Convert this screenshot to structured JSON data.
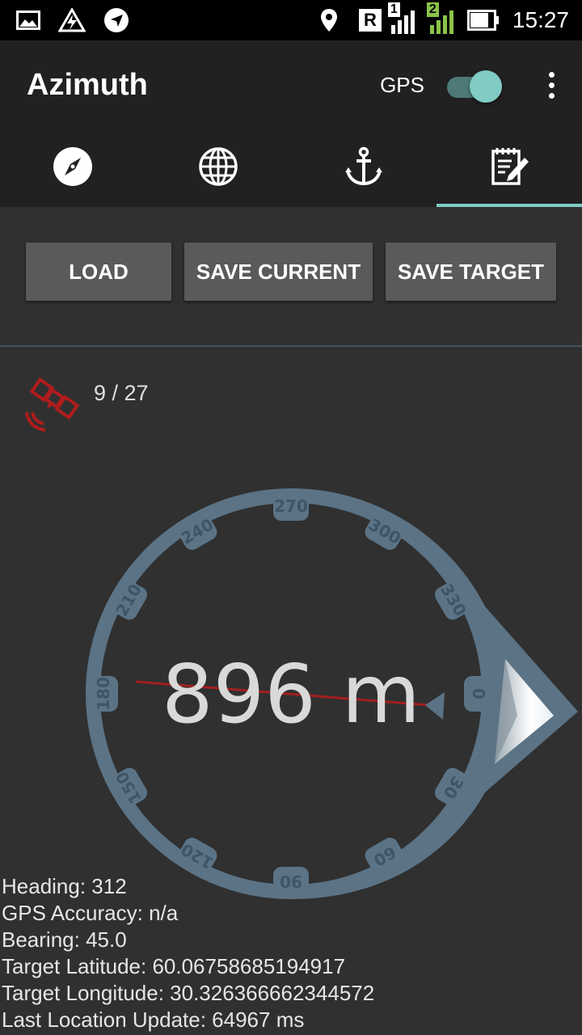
{
  "status_bar": {
    "time": "15:27",
    "sim1_badge": "1",
    "sim2_badge": "2",
    "roaming": "R",
    "icons": [
      "image-icon",
      "storm-icon",
      "navigation-icon",
      "location-pin-icon",
      "signal-icon",
      "battery-icon"
    ]
  },
  "app_bar": {
    "title": "Azimuth",
    "gps_label": "GPS",
    "gps_enabled": true
  },
  "tabs": [
    {
      "icon": "compass-icon",
      "active": false
    },
    {
      "icon": "globe-icon",
      "active": false
    },
    {
      "icon": "anchor-icon",
      "active": false
    },
    {
      "icon": "notepad-edit-icon",
      "active": true
    }
  ],
  "buttons": {
    "load": "LOAD",
    "save_current": "SAVE CURRENT",
    "save_target": "SAVE TARGET"
  },
  "satellites": {
    "text": "9 / 27"
  },
  "compass": {
    "distance": "896 m",
    "dial_labels": [
      "0",
      "30",
      "60",
      "90",
      "120",
      "150",
      "180",
      "210",
      "240",
      "270",
      "300",
      "330"
    ],
    "colors": {
      "dial": "#5b7385",
      "needle": "#a11f1f",
      "accent": "#80cbc4"
    }
  },
  "info": {
    "heading": "Heading: 312",
    "gps_accuracy": "GPS Accuracy: n/a",
    "bearing": "Bearing: 45.0",
    "target_latitude": "Target Latitude: 60.06758685194917",
    "target_longitude": "Target Longitude: 30.326366662344572",
    "last_update": "Last Location Update: 64967 ms"
  }
}
